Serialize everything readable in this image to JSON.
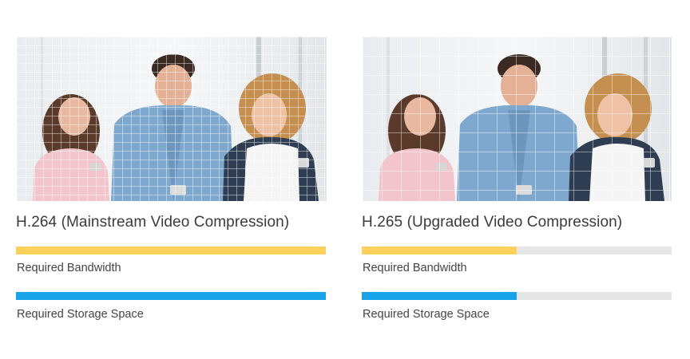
{
  "colors": {
    "bandwidth": "#fcd05a",
    "storage": "#19a3e8",
    "track": "#e6e6e6"
  },
  "panels": [
    {
      "title": "H.264 (Mainstream Video Compression)",
      "image_description": "three-young-people-looking-at-smartphones-with-fine-grid-overlay",
      "bandwidth": {
        "label": "Required Bandwidth",
        "fraction": 1.0
      },
      "storage": {
        "label": "Required Storage Space",
        "fraction": 1.0
      }
    },
    {
      "title": "H.265 (Upgraded Video Compression)",
      "image_description": "three-young-people-looking-at-smartphones-with-coarse-grid-overlay",
      "bandwidth": {
        "label": "Required Bandwidth",
        "fraction": 0.5
      },
      "storage": {
        "label": "Required Storage Space",
        "fraction": 0.5
      }
    }
  ]
}
